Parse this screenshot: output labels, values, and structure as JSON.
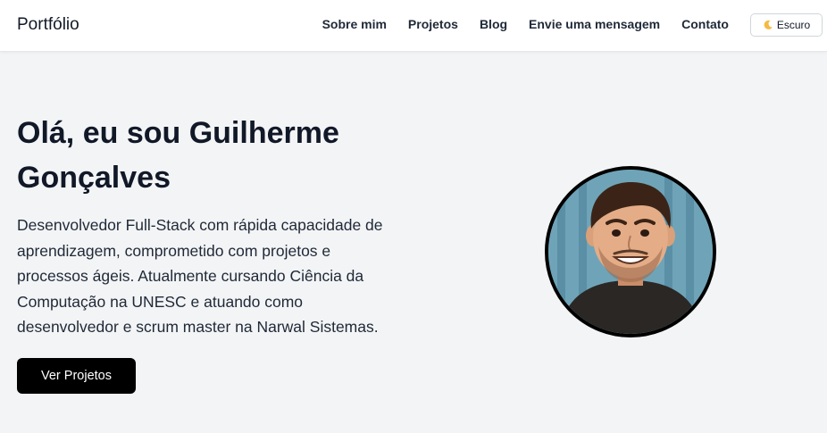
{
  "navbar": {
    "brand": "Portfólio",
    "links": [
      "Sobre mim",
      "Projetos",
      "Blog",
      "Envie uma mensagem",
      "Contato"
    ],
    "theme_toggle": {
      "icon": "moon-icon",
      "label": "Escuro"
    }
  },
  "hero": {
    "title": "Olá, eu sou Guilherme Gonçalves",
    "description": "Desenvolvedor Full-Stack com rápida capacidade de aprendizagem, comprometido com projetos e processos ágeis. Atualmente cursando Ciência da Computação na UNESC e atuando como desenvolvedor e scrum master na Narwal Sistemas.",
    "cta_label": "Ver Projetos"
  },
  "colors": {
    "background": "#f3f4f6",
    "navbar_bg": "#ffffff",
    "text": "#111827",
    "button_bg": "#000000",
    "button_text": "#ffffff",
    "avatar_bg": "#6fa4b8"
  }
}
